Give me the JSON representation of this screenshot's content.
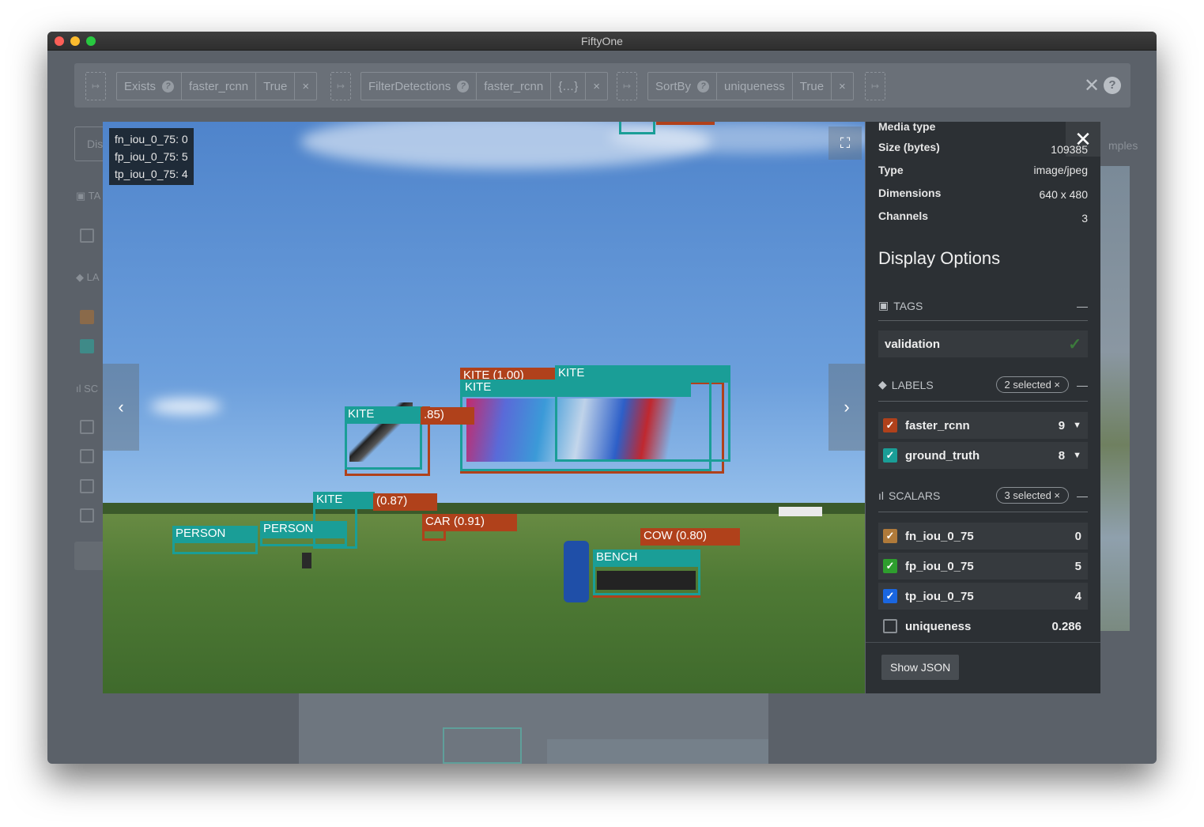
{
  "window": {
    "title": "FiftyOne"
  },
  "pipeline": {
    "stages": [
      {
        "name": "Exists",
        "args": [
          "faster_rcnn",
          "True"
        ]
      },
      {
        "name": "FilterDetections",
        "args": [
          "faster_rcnn",
          "{…}"
        ]
      },
      {
        "name": "SortBy",
        "args": [
          "uniqueness",
          "True"
        ]
      }
    ],
    "arrow_glyph": "↦"
  },
  "background": {
    "display_prefix": "Dis",
    "samples_suffix": "mples",
    "tags_prefix": "TA",
    "labels_prefix": "LA",
    "scalars_prefix": "SC"
  },
  "overlay": {
    "lines": [
      "fn_iou_0_75: 0",
      "fp_iou_0_75: 5",
      "tp_iou_0_75: 4"
    ]
  },
  "detections": [
    {
      "label": "KITE (1.00)",
      "source": "faster_rcnn"
    },
    {
      "label": "KITE",
      "source": "ground_truth"
    },
    {
      "label": "KITE",
      "source": "ground_truth"
    },
    {
      "label": "KITE",
      "source": "ground_truth"
    },
    {
      "label": ".85)",
      "source": "faster_rcnn"
    },
    {
      "label": "KITE",
      "source": "ground_truth"
    },
    {
      "label": "(0.87)",
      "source": "faster_rcnn"
    },
    {
      "label": "CAR (0.91)",
      "source": "faster_rcnn"
    },
    {
      "label": "PERSON",
      "source": "ground_truth"
    },
    {
      "label": "PERSON",
      "source": "ground_truth"
    },
    {
      "label": "COW (0.80)",
      "source": "faster_rcnn"
    },
    {
      "label": "BENCH",
      "source": "ground_truth"
    }
  ],
  "metadata": [
    {
      "key": "Media type",
      "value": ""
    },
    {
      "key": "Size (bytes)",
      "value": "109385"
    },
    {
      "key": "Type",
      "value": "image/jpeg"
    },
    {
      "key": "Dimensions",
      "value": "640 x 480"
    },
    {
      "key": "Channels",
      "value": "3"
    }
  ],
  "display_options": {
    "title": "Display Options",
    "tags": {
      "header": "TAGS",
      "items": [
        {
          "label": "validation"
        }
      ]
    },
    "labels": {
      "header": "LABELS",
      "selected": "2 selected ×",
      "items": [
        {
          "label": "faster_rcnn",
          "count": "9",
          "color": "#b0411b"
        },
        {
          "label": "ground_truth",
          "count": "8",
          "color": "#1a9e97"
        }
      ]
    },
    "scalars": {
      "header": "SCALARS",
      "selected": "3 selected ×",
      "items": [
        {
          "label": "fn_iou_0_75",
          "value": "0",
          "color": "#b07a3a",
          "checked": true
        },
        {
          "label": "fp_iou_0_75",
          "value": "5",
          "color": "#2e9e2e",
          "checked": true
        },
        {
          "label": "tp_iou_0_75",
          "value": "4",
          "color": "#1a66e0",
          "checked": true
        },
        {
          "label": "uniqueness",
          "value": "0.286",
          "color": "",
          "checked": false
        }
      ]
    },
    "show_json": "Show JSON"
  }
}
